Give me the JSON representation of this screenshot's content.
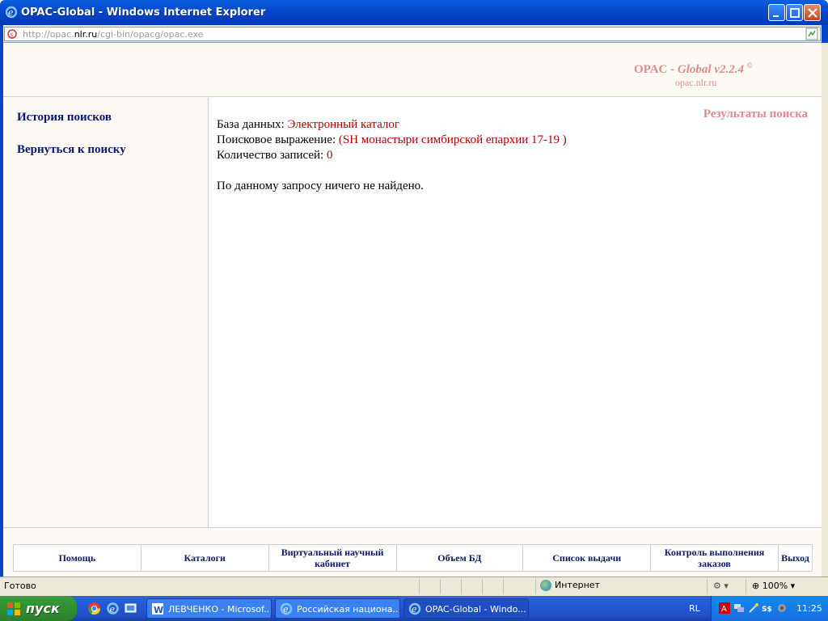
{
  "window": {
    "title": "OPAC-Global - Windows Internet Explorer"
  },
  "address": {
    "url_prefix": "http://opac.",
    "url_host": "nlr.ru",
    "url_suffix": "/cgi-bin/opacg/opac.exe"
  },
  "header": {
    "brand_prefix": "OPAC - ",
    "brand_italic": "Global v2.2.4",
    "brand_sup": "©",
    "brand_sub": "opac.nlr.ru"
  },
  "sidebar": {
    "items": [
      {
        "label": "История поисков"
      },
      {
        "label": "Вернуться к поиску"
      }
    ]
  },
  "content": {
    "results_title": "Результаты поиска",
    "db_label": "База данных: ",
    "db_value": "Электронный каталог",
    "query_label": "Поисковое выражение: ",
    "query_value": "(SH монастыри симбирской епархии 17-19 )",
    "count_label": "Количество записей: ",
    "count_value": "0",
    "message": "По данному запросу ничего не найдено."
  },
  "bottom_nav": {
    "items": [
      {
        "label": "Помощь"
      },
      {
        "label": "Каталоги"
      },
      {
        "label": "Виртуальный научный кабинет"
      },
      {
        "label": "Объем БД"
      },
      {
        "label": "Список выдачи"
      },
      {
        "label": "Контроль выполнения заказов"
      },
      {
        "label": "Выход"
      }
    ]
  },
  "statusbar": {
    "status": "Готово",
    "zone": "Интернет",
    "zoom": "100%"
  },
  "taskbar": {
    "start_label": "пуск",
    "tasks": [
      {
        "label": "ЛЕВЧЕНКО - Microsof..."
      },
      {
        "label": "Российская национа..."
      },
      {
        "label": "OPAC-Global - Windo..."
      }
    ],
    "language": "RL",
    "clock": "11:25"
  },
  "colors": {
    "brand": "#e08a8a",
    "nav_text": "#0a1a6a",
    "value_text": "#b00000",
    "panel_bg": "#fdfaf5"
  }
}
